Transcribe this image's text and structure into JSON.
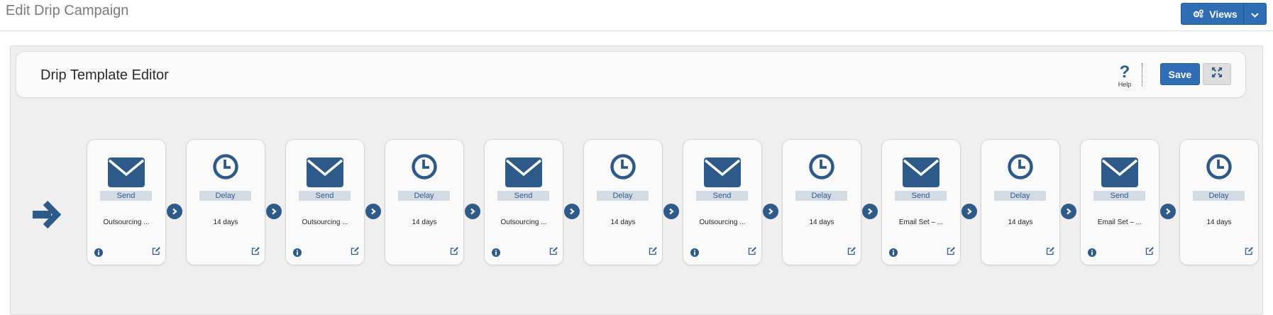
{
  "page": {
    "title": "Edit Drip Campaign",
    "views_label": "Views"
  },
  "editor": {
    "title": "Drip Template Editor",
    "help_mark": "?",
    "help_label": "Help",
    "save_label": "Save"
  },
  "colors": {
    "primary": "#2f6eb5",
    "icon": "#2e5a8a",
    "badge_bg": "#d3dbe5"
  },
  "steps": [
    {
      "type": "Send",
      "label": "Outsourcing ...",
      "icon": "envelope-icon"
    },
    {
      "type": "Delay",
      "label": "14 days",
      "icon": "clock-icon"
    },
    {
      "type": "Send",
      "label": "Outsourcing ...",
      "icon": "envelope-icon"
    },
    {
      "type": "Delay",
      "label": "14 days",
      "icon": "clock-icon"
    },
    {
      "type": "Send",
      "label": "Outsourcing ...",
      "icon": "envelope-icon"
    },
    {
      "type": "Delay",
      "label": "14 days",
      "icon": "clock-icon"
    },
    {
      "type": "Send",
      "label": "Outsourcing ...",
      "icon": "envelope-icon"
    },
    {
      "type": "Delay",
      "label": "14 days",
      "icon": "clock-icon"
    },
    {
      "type": "Send",
      "label": "Email Set – ...",
      "icon": "envelope-icon"
    },
    {
      "type": "Delay",
      "label": "14 days",
      "icon": "clock-icon"
    },
    {
      "type": "Send",
      "label": "Email Set – ...",
      "icon": "envelope-icon"
    },
    {
      "type": "Delay",
      "label": "14 days",
      "icon": "clock-icon"
    }
  ]
}
